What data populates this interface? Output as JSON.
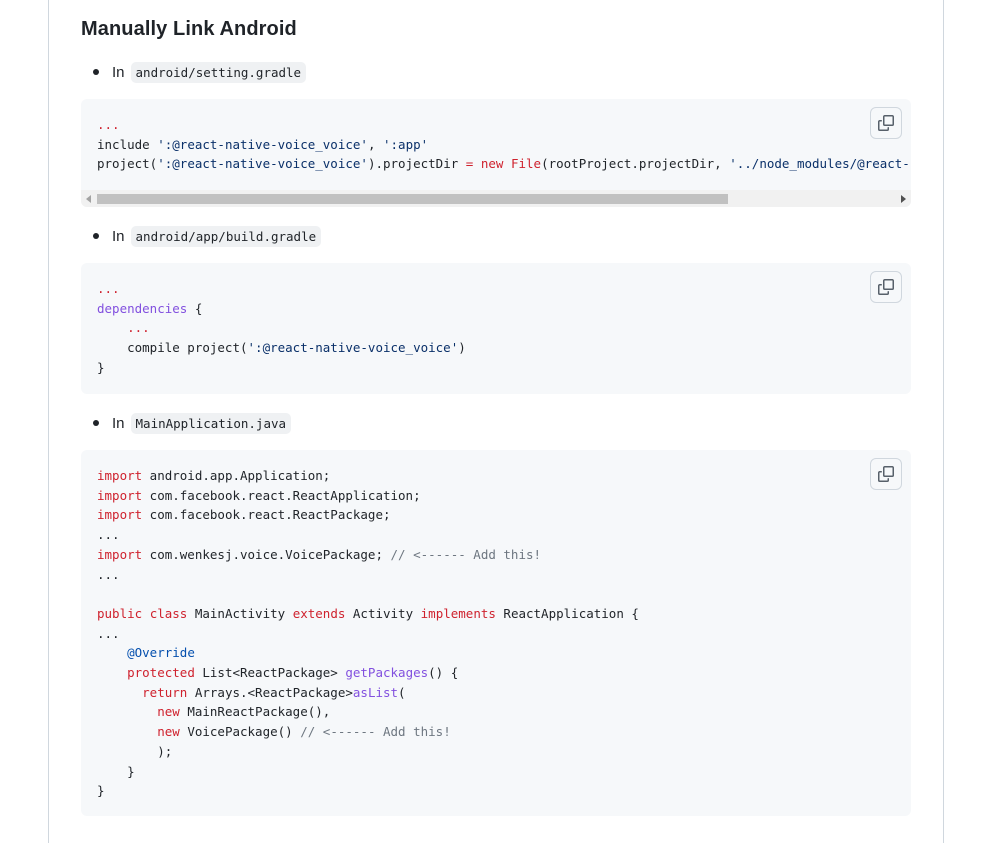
{
  "section": {
    "title": "Manually Link Android"
  },
  "items": [
    {
      "prefix": "In",
      "file": "android/setting.gradle",
      "code": {
        "line1": "...",
        "line2_a": "include ",
        "line2_b": "':@react-native-voice_voice'",
        "line2_c": ", ",
        "line2_d": "':app'",
        "line3_a": "project(",
        "line3_b": "':@react-native-voice_voice'",
        "line3_c": ").projectDir ",
        "line3_d": "=",
        "line3_e": " ",
        "line3_f": "new",
        "line3_g": " ",
        "line3_h": "File",
        "line3_i": "(rootProject.projectDir, ",
        "line3_j": "'../node_modules/@react-native-voice/voice/android'",
        "line3_k": ")"
      }
    },
    {
      "prefix": "In",
      "file": "android/app/build.gradle",
      "code": {
        "line1": "...",
        "line2_a": "dependencies",
        "line2_b": " {",
        "line3": "...",
        "line4_a": "    compile project(",
        "line4_b": "':@react-native-voice_voice'",
        "line4_c": ")",
        "line5": "}"
      }
    },
    {
      "prefix": "In",
      "file": "MainApplication.java",
      "code": {
        "kw_import": "import",
        "l1": " android.app.Application;",
        "l2": " com.facebook.react.ReactApplication;",
        "l3": " com.facebook.react.ReactPackage;",
        "l4": "...",
        "l5": " com.wenkesj.voice.VoicePackage; ",
        "c5": "// <------ Add this!",
        "l6": "...",
        "kw_public": "public",
        "kw_class": "class",
        "l8_name": " MainActivity ",
        "kw_extends": "extends",
        "l8_mid": " Activity ",
        "kw_implements": "implements",
        "l8_end": " ReactApplication {",
        "l9": "...",
        "anno": "@Override",
        "kw_protected": "protected",
        "l11_type": " List<ReactPackage> ",
        "fn_getPackages": "getPackages",
        "l11_end": "() {",
        "kw_return": "return",
        "l12_mid": " Arrays.<ReactPackage>",
        "fn_asList": "asList",
        "l12_end": "(",
        "kw_new": "new",
        "l13": " MainReactPackage(),",
        "l14": " VoicePackage() ",
        "c14": "// <------ Add this!",
        "l15": ");",
        "l16": "}",
        "l17": "}"
      }
    }
  ]
}
